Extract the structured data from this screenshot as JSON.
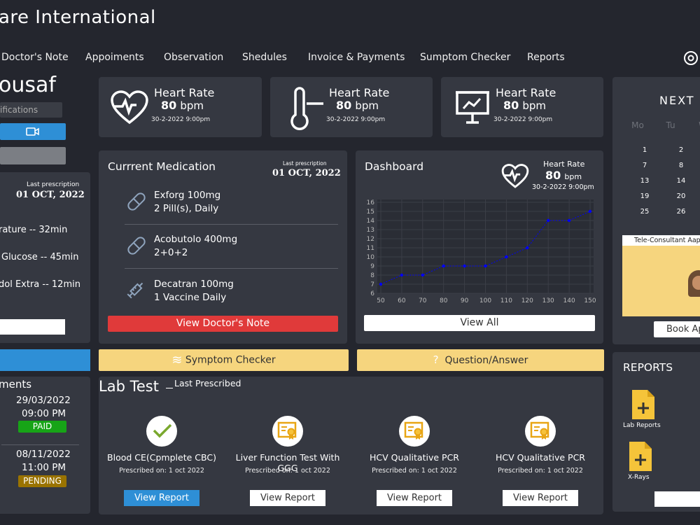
{
  "app_title": "are International",
  "nav": [
    "Doctor's Note",
    "Appoiments",
    "Observation",
    "Shedules",
    "Invoice & Payments",
    "Sumptom Checker",
    "Reports"
  ],
  "profile": {
    "name": "ousaf",
    "notifications_label": "ifications"
  },
  "left_prescription": {
    "caption": "Last prescription",
    "date": "01 OCT, 2022",
    "items": [
      "rature -- 32min",
      "Glucose -- 45min",
      "dol Extra -- 12min"
    ]
  },
  "appointments": {
    "title": "ments",
    "items": [
      {
        "date": "29/03/2022",
        "time": "09:00 PM",
        "status": "PAID"
      },
      {
        "date": "08/11/2022",
        "time": "11:00 PM",
        "status": "PENDING"
      }
    ]
  },
  "vitals": [
    {
      "title": "Heart Rate",
      "value": "80",
      "unit": "bpm",
      "date": "30-2-2022 9:00pm",
      "icon": "heart-pulse-icon"
    },
    {
      "title": "Heart Rate",
      "value": "80",
      "unit": "bpm",
      "date": "30-2-2022 9:00pm",
      "icon": "thermometer-icon"
    },
    {
      "title": "Heart Rate",
      "value": "80",
      "unit": "bpm",
      "date": "30-2-2022 9:00pm",
      "icon": "monitor-chart-icon"
    }
  ],
  "medication": {
    "title": "Currrent Medication",
    "last_caption": "Last prescription",
    "last_date": "01 OCT, 2022",
    "items": [
      {
        "name": "Exforg 100mg",
        "dose": "2 Pill(s), Daily",
        "icon": "pill-icon"
      },
      {
        "name": "Acobutolo 400mg",
        "dose": "2+0+2",
        "icon": "pill-icon"
      },
      {
        "name": "Decatran 100mg",
        "dose": "1 Vaccine Daily",
        "icon": "syringe-icon"
      }
    ],
    "button": "View Doctor's Note"
  },
  "dashboard": {
    "title": "Dashboard",
    "hr_title": "Heart Rate",
    "hr_value": "80",
    "hr_unit": "bpm",
    "hr_date": "30-2-2022 9:00pm",
    "button": "View All"
  },
  "chart_data": {
    "type": "line",
    "x": [
      50,
      60,
      70,
      80,
      90,
      100,
      110,
      120,
      130,
      140,
      150
    ],
    "series": [
      {
        "values": [
          7,
          8,
          8,
          9,
          9,
          9,
          10,
          11,
          14,
          14,
          15
        ]
      }
    ],
    "xlim": [
      50,
      150
    ],
    "ylim": [
      6,
      16
    ],
    "yticks": [
      6,
      7,
      8,
      9,
      10,
      11,
      12,
      13,
      14,
      15,
      16
    ],
    "grid": true,
    "color": "#0000ff"
  },
  "calendar": {
    "title": "NEXT",
    "headers": [
      "Mo",
      "Tu",
      "W"
    ],
    "rows": [
      [
        "1",
        "2"
      ],
      [
        "7",
        "8"
      ],
      [
        "13",
        "14"
      ],
      [
        "19",
        "20"
      ],
      [
        "25",
        "26"
      ]
    ]
  },
  "teleconsult": {
    "label": "Tele-Consultant Aap",
    "button": "Book Ap"
  },
  "symptom_checker": "Symptom Checker",
  "question_answer": "Question/Answer",
  "lab": {
    "title": "Lab Test",
    "subtitle": "Last Prescribed",
    "tests": [
      {
        "name": "Blood CE(Cpmplete CBC)",
        "prescribed": "Prescribed on: 1 oct 2022",
        "button": "View Report",
        "icon": "check-icon"
      },
      {
        "name": "Liver Function Test With GGG",
        "prescribed": "Prescribed on: 1 oct 2022",
        "button": "View Report",
        "icon": "certificate-icon"
      },
      {
        "name": "HCV Qualitative PCR",
        "prescribed": "Prescribed on: 1 oct 2022",
        "button": "View Report",
        "icon": "certificate-icon"
      },
      {
        "name": "HCV Qualitative PCR",
        "prescribed": "Prescribed on: 1 oct 2022",
        "button": "View Report",
        "icon": "certificate-icon"
      }
    ]
  },
  "reports": {
    "title": "REPORTS",
    "items": [
      "Lab Reports",
      "X-Rays"
    ]
  },
  "colors": {
    "bg": "#24262e",
    "card": "#353841",
    "accent_blue": "#2e8fd6",
    "red": "#e03a3a",
    "yellow": "#f6d57e",
    "paid": "#17a417",
    "pending": "#9a7300",
    "file_yellow": "#f5c43a"
  }
}
